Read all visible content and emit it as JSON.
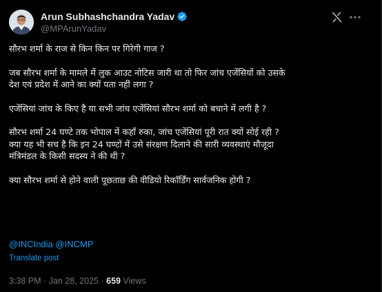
{
  "author": {
    "display_name": "Arun Subhashchandra Yadav",
    "handle": "@MPArunYadav",
    "verified": true
  },
  "post": {
    "paragraphs": [
      [
        "सौरभ शर्मा के राज से किन किन पर गिरेगी गाज ?"
      ],
      [
        "जब सौरभ शर्मा के मामले में लुक आउट नोटिस जारी था तो फिर जांच एजेंसियों को उसके",
        "देश एवं प्रदेश में आने का क्यों पता नहीं लगा ?"
      ],
      [
        "एजेंसियां जांच के किए है या सभी जांच एजेंसियां सौरभ शर्मा को बचाने में लगी है ?"
      ],
      [
        "सौरभ शर्मा 24 घण्टे तक भोपाल में कहाँ रुका, जांच एजेंसियां पूरी रात क्यों सोई रही ?",
        "क्या यह भी सच है कि इन 24 घण्टों में उसे संरक्षण दिलाने की सारी व्यवस्थाएं मौजूदा",
        "मंत्रिमंडल के किसी सदस्य ने की थी ?"
      ],
      [
        "क्या सौरभ शर्मा से होने वाली पूछताछ की वीडियो रिकॉर्डिंग सार्वजनिक होगी ?"
      ]
    ],
    "mentions": [
      "@INCIndia",
      "@INCMP"
    ],
    "translate_label": "Translate post",
    "time": "3:38 PM",
    "separator": "·",
    "date": "Jan 28, 2025",
    "views_count": "659",
    "views_label": "Views"
  },
  "icons": {
    "verified": "verified-badge-icon",
    "grok": "grok-icon",
    "more": "more-options-icon"
  },
  "colors": {
    "background": "#000000",
    "text": "#e7e9ea",
    "muted": "#71767b",
    "link": "#1d9bf0",
    "verified": "#1d9bf0"
  }
}
